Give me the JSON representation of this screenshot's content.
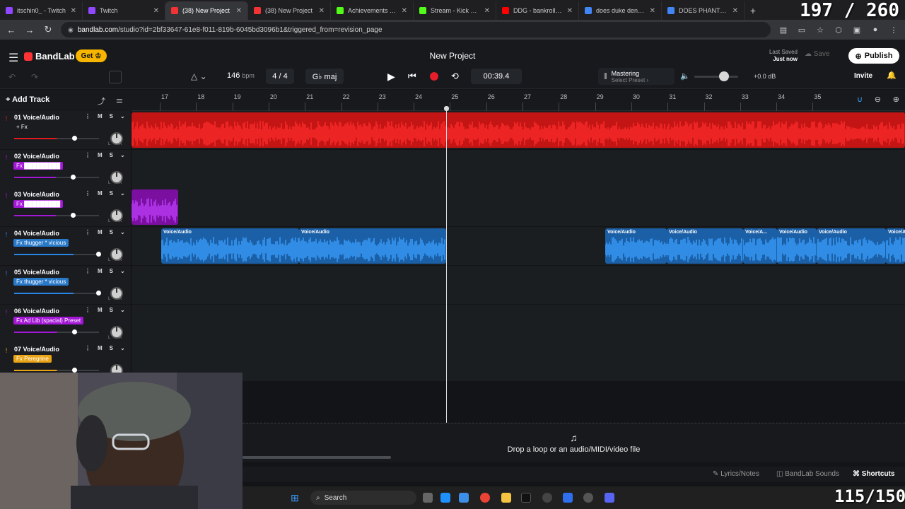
{
  "browser": {
    "tabs": [
      {
        "label": "itschin0_ - Twitch",
        "color": "#9146ff"
      },
      {
        "label": "Twitch",
        "color": "#9146ff"
      },
      {
        "label": "(38) New Project",
        "color": "#f33333",
        "active": true
      },
      {
        "label": "(38) New Project",
        "color": "#f33333"
      },
      {
        "label": "Achievements - Kick",
        "color": "#53fc18"
      },
      {
        "label": "Stream - Kick Dash",
        "color": "#53fc18"
      },
      {
        "label": "DDG - bankroll (Offi",
        "color": "#ff0000"
      },
      {
        "label": "does duke dennis p",
        "color": "#4285f4"
      },
      {
        "label": "DOES PHANTOM R",
        "color": "#4285f4"
      }
    ],
    "new_tab": "+",
    "overlay_counter": "197 / 260",
    "url_domain": "bandlab.com",
    "url_path": "/studio?id=2bf33647-61e8-f011-819b-6045bd3096b1&triggered_from=revision_page"
  },
  "app": {
    "brand": "BandLab",
    "get_label": "Get",
    "project_title": "New Project",
    "last_saved_label": "Last Saved",
    "last_saved_value": "Just now",
    "save_label": "Save",
    "publish_label": "Publish",
    "bpm": "146",
    "bpm_unit": "bpm",
    "time_signature": "4 / 4",
    "key": "G♭ maj",
    "clock": "00:39.4",
    "mastering_title": "Mastering",
    "mastering_sub": "Select Preset",
    "master_db": "+0.0 dB",
    "invite_label": "Invite",
    "add_track_label": "Add Track"
  },
  "ruler": {
    "bars": [
      "17",
      "18",
      "19",
      "20",
      "21",
      "22",
      "23",
      "24",
      "25",
      "26",
      "27",
      "28",
      "29",
      "30",
      "31",
      "32",
      "33",
      "34",
      "35"
    ]
  },
  "tracks": [
    {
      "name": "01  Voice/Audio",
      "fx": "+ Fx",
      "fx_color": "#1a1c20",
      "color": "#e01b1b",
      "vol": 0.72
    },
    {
      "name": "02  Voice/Audio",
      "fx": "Fx █████████",
      "fx_color": "#a417d6",
      "color": "#a417d6",
      "vol": 0.7
    },
    {
      "name": "03  Voice/Audio",
      "fx": "Fx █████████",
      "fx_color": "#a417d6",
      "color": "#a417d6",
      "vol": 0.7
    },
    {
      "name": "04  Voice/Audio",
      "fx": "Fx thugger * vicious",
      "fx_color": "#2979c9",
      "color": "#2a86e6",
      "vol": 1.0
    },
    {
      "name": "05  Voice/Audio",
      "fx": "Fx thugger * vicious",
      "fx_color": "#2979c9",
      "color": "#2a86e6",
      "vol": 1.0
    },
    {
      "name": "06  Voice/Audio",
      "fx": "Fx Ad Lib (spacial) Preset",
      "fx_color": "#a417d6",
      "color": "#a417d6",
      "vol": 0.72
    },
    {
      "name": "07  Voice/Audio",
      "fx": "Fx Peregrine",
      "fx_color": "#e8a317",
      "color": "#e8a317",
      "vol": 0.72
    }
  ],
  "clips": {
    "voice_label": "Voice/Audio",
    "voice_label_short": "Voice/A..."
  },
  "dropzone_text": "Drop a loop or an audio/MIDI/video file",
  "bottom": {
    "lyrics_label": "Lyrics/Notes",
    "sounds_label": "BandLab Sounds",
    "shortcuts_label": "Shortcuts"
  },
  "taskbar": {
    "search_label": "Search",
    "overlay_counter": "115/150"
  }
}
